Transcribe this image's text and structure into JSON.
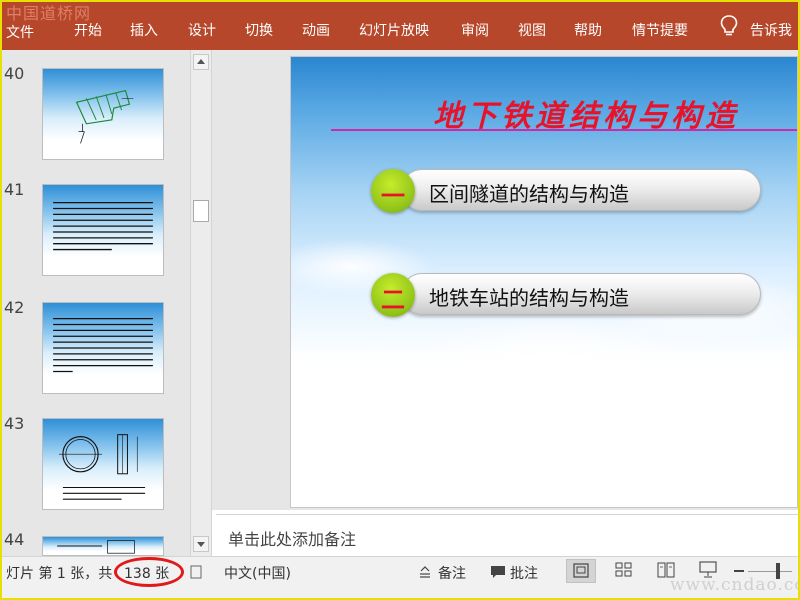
{
  "watermark_top": "中国道桥网",
  "watermark_bottom": "www.cndao.com",
  "ribbon": {
    "tabs": [
      "文件",
      "开始",
      "插入",
      "设计",
      "切换",
      "动画",
      "幻灯片放映",
      "审阅",
      "视图",
      "帮助",
      "情节提要"
    ],
    "tellme": "告诉我"
  },
  "thumbnails": [
    {
      "number": "40"
    },
    {
      "number": "41"
    },
    {
      "number": "42"
    },
    {
      "number": "43"
    },
    {
      "number": "44"
    }
  ],
  "slide": {
    "title": "地下铁道结构与构造",
    "items": [
      {
        "num": "一",
        "label": "区间隧道的结构与构造"
      },
      {
        "num": "二",
        "label": "地铁车站的结构与构造"
      }
    ]
  },
  "notes_placeholder": "单击此处添加备注",
  "statusbar": {
    "slide_info_prefix": "灯片 第 1 张，共",
    "slide_total": "138 张",
    "language": "中文(中国)",
    "notes_label": "备注",
    "comments_label": "批注"
  },
  "colors": {
    "ribbon": "#b7472a",
    "title": "#e8132b",
    "title_line": "#cc2aa8",
    "number_circle": "#8fc21a",
    "highlight": "#e01919",
    "frame": "#e8e000"
  }
}
